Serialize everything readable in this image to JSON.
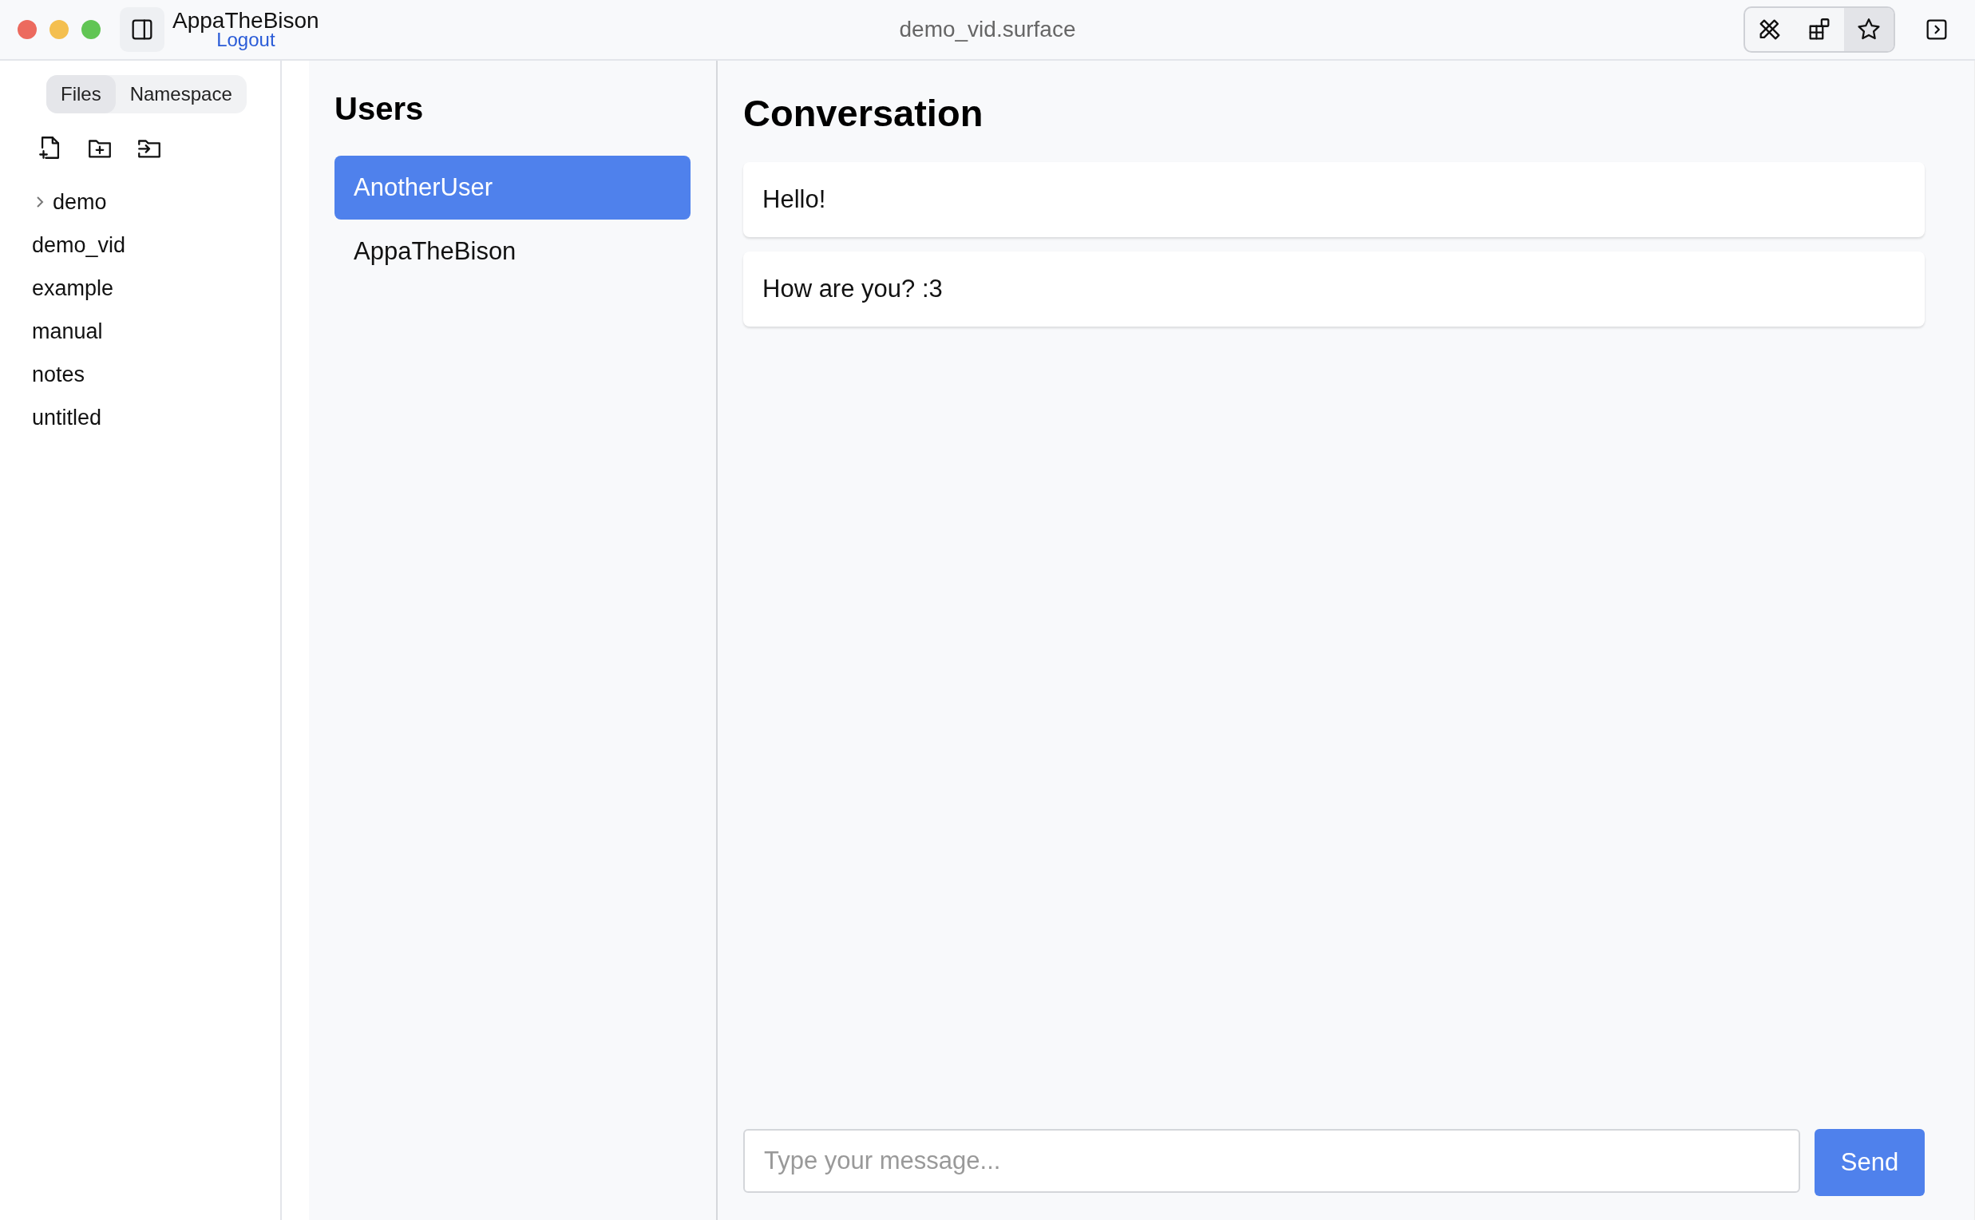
{
  "window": {
    "title": "demo_vid.surface",
    "controls": [
      {
        "color": "#ec6a5e"
      },
      {
        "color": "#f4bf4f"
      },
      {
        "color": "#61c554"
      }
    ]
  },
  "account": {
    "username": "AppaTheBison",
    "logout": "Logout"
  },
  "modes": [
    {
      "kind": "tools",
      "selected": false
    },
    {
      "kind": "widgets",
      "selected": false
    },
    {
      "kind": "star",
      "selected": true
    }
  ],
  "sidebar": {
    "tabs": [
      {
        "label": "Files",
        "selected": true
      },
      {
        "label": "Namespace",
        "selected": false
      }
    ],
    "items": [
      {
        "label": "demo",
        "kind": "folder",
        "expanded": false
      },
      {
        "label": "demo_vid",
        "kind": "file"
      },
      {
        "label": "example",
        "kind": "file"
      },
      {
        "label": "manual",
        "kind": "file"
      },
      {
        "label": "notes",
        "kind": "file"
      },
      {
        "label": "untitled",
        "kind": "file"
      }
    ]
  },
  "users": {
    "title": "Users",
    "items": [
      {
        "name": "AnotherUser",
        "selected": true
      },
      {
        "name": "AppaTheBison",
        "selected": false
      }
    ]
  },
  "conversation": {
    "title": "Conversation",
    "messages": [
      "Hello!",
      "How are you? :3"
    ],
    "input": {
      "placeholder": "Type your message..."
    },
    "send": "Send"
  }
}
